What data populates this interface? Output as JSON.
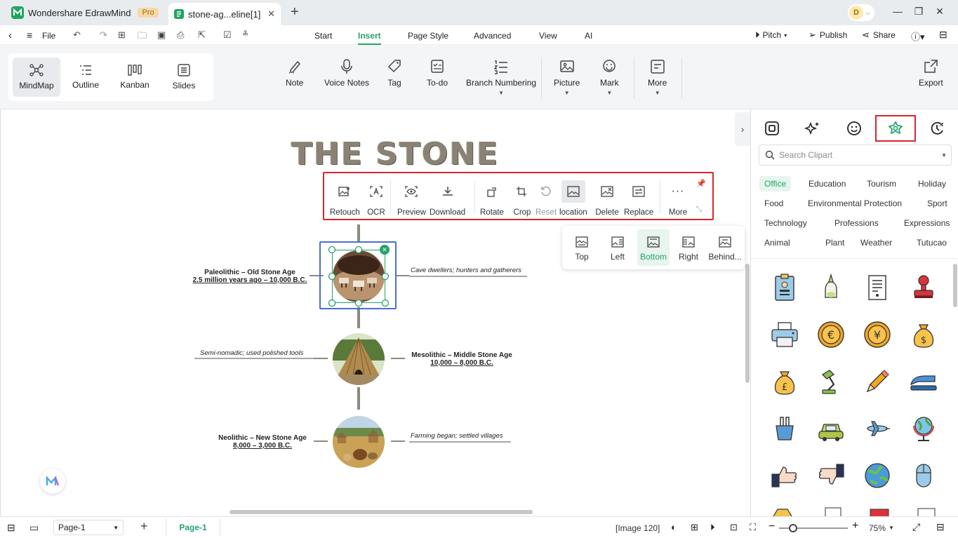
{
  "app": {
    "name": "Wondershare EdrawMind",
    "badge": "Pro",
    "doc_tab": "stone-ag...eline[1]",
    "new_tab": "+",
    "avatar_letter": "D"
  },
  "quickbar": {
    "file": "File"
  },
  "menu": {
    "tabs": [
      "Start",
      "Insert",
      "Page Style",
      "Advanced",
      "View",
      "AI"
    ],
    "active": "Insert",
    "pitch": "Pitch",
    "publish": "Publish",
    "share": "Share"
  },
  "views": [
    {
      "label": "MindMap",
      "icon": "mindmap-icon"
    },
    {
      "label": "Outline",
      "icon": "outline-icon"
    },
    {
      "label": "Kanban",
      "icon": "kanban-icon"
    },
    {
      "label": "Slides",
      "icon": "slides-icon"
    }
  ],
  "ribbon": {
    "note": "Note",
    "voice": "Voice Notes",
    "tag": "Tag",
    "todo": "To-do",
    "branch": "Branch Numbering",
    "picture": "Picture",
    "mark": "Mark",
    "more": "More",
    "export": "Export"
  },
  "image_toolbar": {
    "retouch": "Retouch",
    "ocr": "OCR",
    "preview": "Preview",
    "download": "Download",
    "rotate": "Rotate",
    "crop": "Crop",
    "reset": "Reset",
    "location": "location",
    "delete": "Delete",
    "replace": "Replace",
    "more": "More"
  },
  "location_popup": {
    "items": [
      "Top",
      "Left",
      "Bottom",
      "Right",
      "Behind..."
    ],
    "active": "Bottom"
  },
  "mindmap": {
    "title": "THE STONE",
    "nodes": [
      {
        "title": "Paleolithic – Old Stone Age",
        "date": "2.5 million years ago – 10,000 B.C.",
        "note": "Cave dwellers; hunters and gatherers"
      },
      {
        "title": "Mesolithic – Middle Stone Age",
        "date": "10,000 – 8,000 B.C.",
        "note": "Semi-nomadic; used polished tools"
      },
      {
        "title": "Neolithic – New Stone Age",
        "date": "8,000 – 3,000 B.C.",
        "note": "Farming began; settled villages"
      }
    ]
  },
  "panel": {
    "search_placeholder": "Search Clipart",
    "categories": [
      "Office",
      "Education",
      "Tourism",
      "Holiday",
      "Food",
      "Environmental Protection",
      "Sport",
      "Technology",
      "Professions",
      "Expressions",
      "Animal",
      "Plant",
      "Weather",
      "Tutucao"
    ],
    "active_category": "Office",
    "clipart": [
      "id-badge-icon",
      "glue-bottle-icon",
      "document-icon",
      "stamp-icon",
      "printer-icon",
      "euro-coin-icon",
      "yen-coin-icon",
      "dollar-bag-icon",
      "pound-bag-icon",
      "desk-lamp-icon",
      "pencil-icon",
      "stapler-icon",
      "binder-clip-icon",
      "car-icon",
      "airplane-icon",
      "globe-stand-icon",
      "thumbs-up-icon",
      "thumbs-down-icon",
      "earth-icon",
      "mouse-icon"
    ]
  },
  "status": {
    "page_select": "Page-1",
    "page_tab": "Page-1",
    "image_info": "[Image 120]",
    "zoom": "75%"
  },
  "colors": {
    "accent": "#23a36a",
    "highlight": "#d9252a",
    "selection": "#4a6fd0"
  }
}
